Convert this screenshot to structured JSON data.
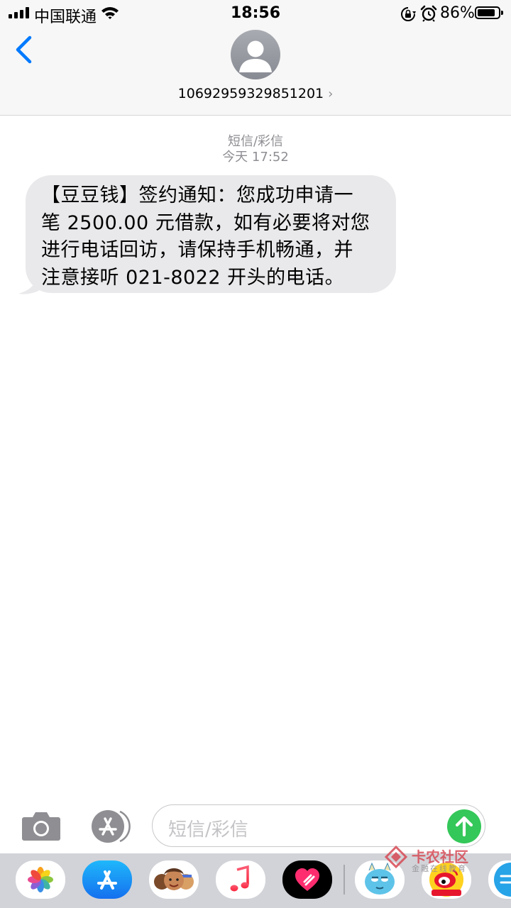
{
  "status_bar": {
    "carrier": "中国联通",
    "time": "18:56",
    "battery_percent": "86%",
    "battery_level": 0.86,
    "icons": [
      "signal-bars-icon",
      "wifi-icon",
      "orientation-lock-icon",
      "alarm-icon",
      "battery-icon"
    ]
  },
  "header": {
    "back_icon": "chevron-left-icon",
    "avatar_icon": "person-silhouette-icon",
    "contact_number": "10692959329851201",
    "contact_chevron": "›"
  },
  "thread": {
    "service_label": "短信/彩信",
    "timestamp": "今天 17:52",
    "messages": [
      {
        "direction": "incoming",
        "lines": [
          "【豆豆钱】签约通知：您成功申请一",
          "笔 2500.00 元借款，如有必要将对您",
          "进行电话回访，请保持手机畅通，并",
          "注意接听 021-8022 开头的电话。"
        ]
      }
    ]
  },
  "composer": {
    "camera_icon": "camera-icon",
    "apps_icon": "app-store-icon",
    "placeholder": "短信/彩信",
    "send_icon": "arrow-up-icon",
    "send_color": "#34c759"
  },
  "app_drawer": {
    "apps": [
      "photos-icon",
      "app-store-icon",
      "memoji-icon",
      "music-icon",
      "digital-touch-icon",
      "monster-sticker-icon",
      "weibo-icon",
      "partial-app-icon"
    ]
  },
  "watermark": {
    "title": "卡农社区",
    "subtitle": "金融在线教育"
  },
  "colors": {
    "ios_blue": "#007aff",
    "bubble_gray": "#e9e9eb",
    "meta_gray": "#8e8e93"
  }
}
